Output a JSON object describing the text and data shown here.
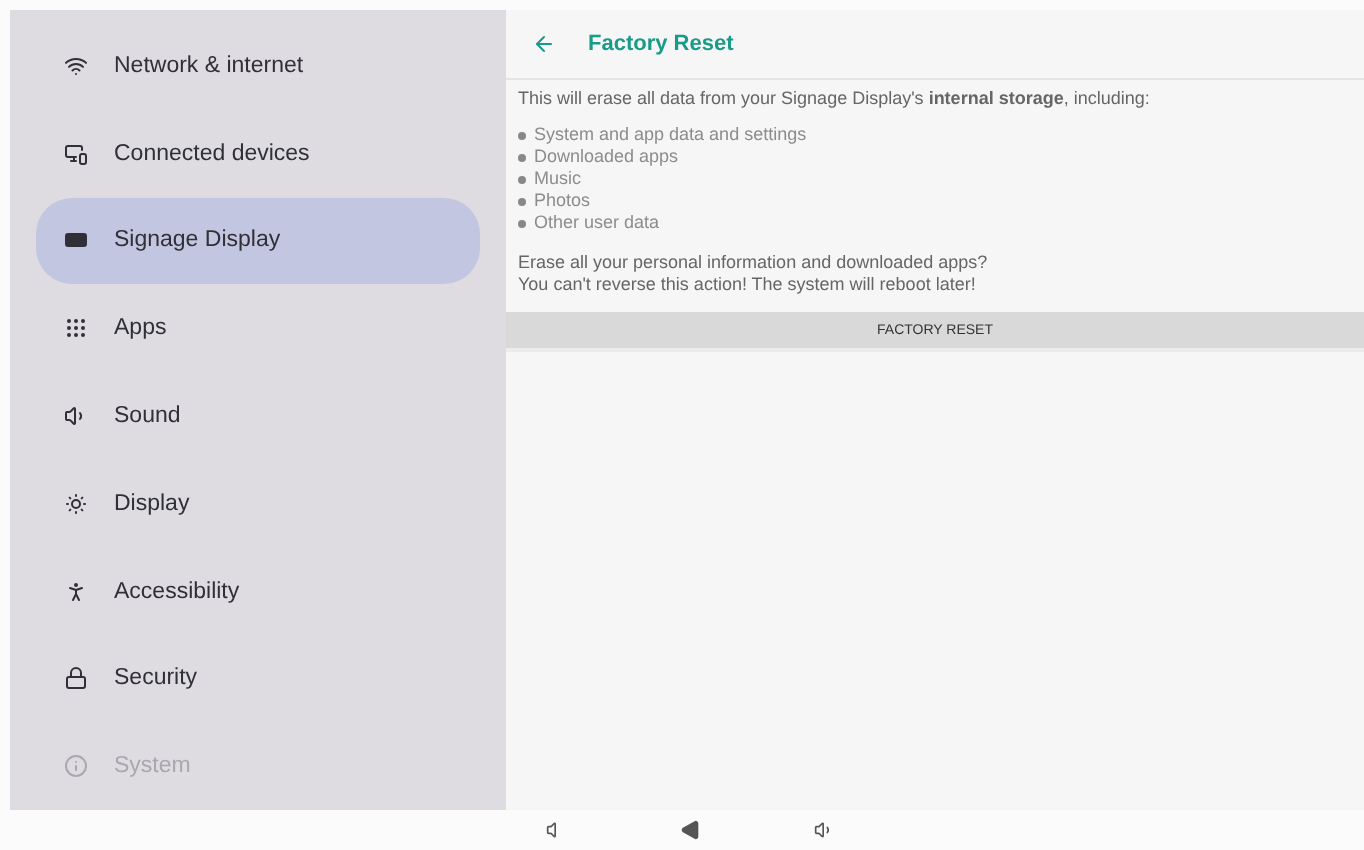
{
  "sidebar": {
    "items": [
      {
        "label": "Network & internet",
        "selected": false
      },
      {
        "label": "Connected devices",
        "selected": false
      },
      {
        "label": "Signage Display",
        "selected": true
      },
      {
        "label": "Apps",
        "selected": false
      },
      {
        "label": "Sound",
        "selected": false
      },
      {
        "label": "Display",
        "selected": false
      },
      {
        "label": "Accessibility",
        "selected": false
      },
      {
        "label": "Security",
        "selected": false
      },
      {
        "label": "System",
        "selected": false,
        "disabled": true
      }
    ]
  },
  "header": {
    "title": "Factory Reset"
  },
  "content": {
    "intro": "This will erase all data from your Signage Display's **internal storage**, including:",
    "list": [
      "System and app data and settings",
      "Downloaded apps",
      "Music",
      "Photos",
      "Other user data"
    ],
    "warning": [
      "Erase all your personal information and downloaded apps?",
      "You can't reverse this action! The system will reboot later!"
    ],
    "button": "FACTORY RESET"
  }
}
